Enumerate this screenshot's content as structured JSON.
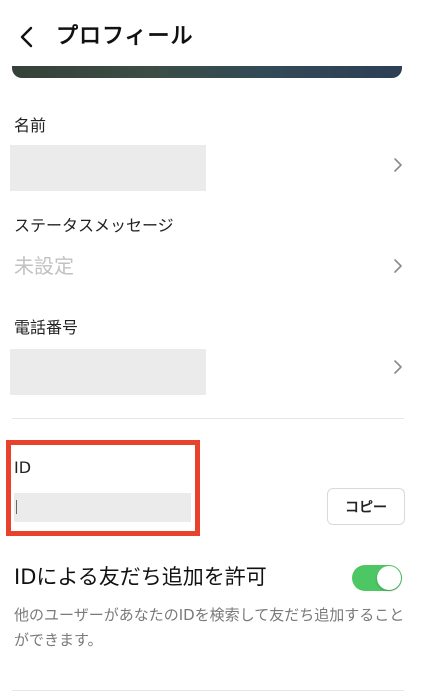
{
  "header": {
    "back_icon": "chevron-left-icon",
    "title": "プロフィール"
  },
  "name": {
    "label": "名前",
    "value_redacted": true
  },
  "status_message": {
    "label": "ステータスメッセージ",
    "value": "未設定"
  },
  "phone": {
    "label": "電話番号",
    "value_redacted": true
  },
  "id_section": {
    "label": "ID",
    "value_redacted": true,
    "copy_label": "コピー",
    "highlight_color": "#e8412c"
  },
  "id_search": {
    "title": "IDによる友だち追加を許可",
    "description": "他のユーザーがあなたのIDを検索して友だち追加することができます。",
    "enabled": true,
    "toggle_color": "#4cc764"
  },
  "icons": {
    "row_arrow": "chevron-right-icon"
  }
}
